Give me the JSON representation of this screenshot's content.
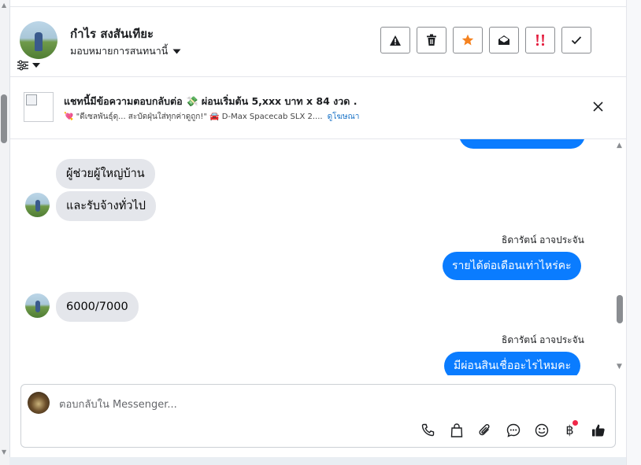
{
  "contact": {
    "name": "กำไร สงสันเทียะ",
    "assign_label": "มอบหมายการสนทนานี้"
  },
  "header_actions": [
    {
      "icon": "warning-icon",
      "color": "#1c1e21"
    },
    {
      "icon": "trash-icon",
      "color": "#1c1e21"
    },
    {
      "icon": "star-icon",
      "color": "#f5821f"
    },
    {
      "icon": "envelope-open-icon",
      "color": "#1c1e21"
    },
    {
      "icon": "urgent-icon",
      "color": "#e41e3f"
    },
    {
      "icon": "check-icon",
      "color": "#1c1e21"
    }
  ],
  "ad": {
    "title": "แชทนี้มีข้อความตอบกลับต่อ 💸 ผ่อนเริ่มต้น 5,xxx บาท x 84 งวด .",
    "subtitle": "💘 \"ดีเซลพันธุ์ดุ... สะบัดฝุ่นใส่ทุกค่าดูถูก!\" 🚘 D-Max Spacecab SLX 2....",
    "link": "ดูโฆษณา"
  },
  "messages": [
    {
      "from": "contact",
      "text": "ผู้ช่วยผู้ใหญ่บ้าน"
    },
    {
      "from": "contact",
      "text": "และรับจ้างทั่วไป"
    },
    {
      "from": "page",
      "sender": "ธิดารัตน์ อาจประจัน",
      "text": "รายได้ต่อเดือนเท่าไหร่คะ"
    },
    {
      "from": "contact",
      "text": "6000/7000"
    },
    {
      "from": "page",
      "sender": "ธิดารัตน์ อาจประจัน",
      "text": "มีผ่อนสินเชื่ออะไรไหมคะ"
    }
  ],
  "composer": {
    "placeholder": "ตอบกลับใน Messenger...",
    "tools": [
      "phone-icon",
      "shopping-bag-icon",
      "paperclip-icon",
      "chat-bubble-icon",
      "emoji-icon",
      "baht-icon",
      "thumbs-up-icon"
    ],
    "baht_symbol": "฿",
    "notification_color": "#f02849"
  },
  "colors": {
    "outgoing_bubble": "#0a7cff",
    "incoming_bubble": "#e4e6eb",
    "link": "#1a73c7"
  }
}
